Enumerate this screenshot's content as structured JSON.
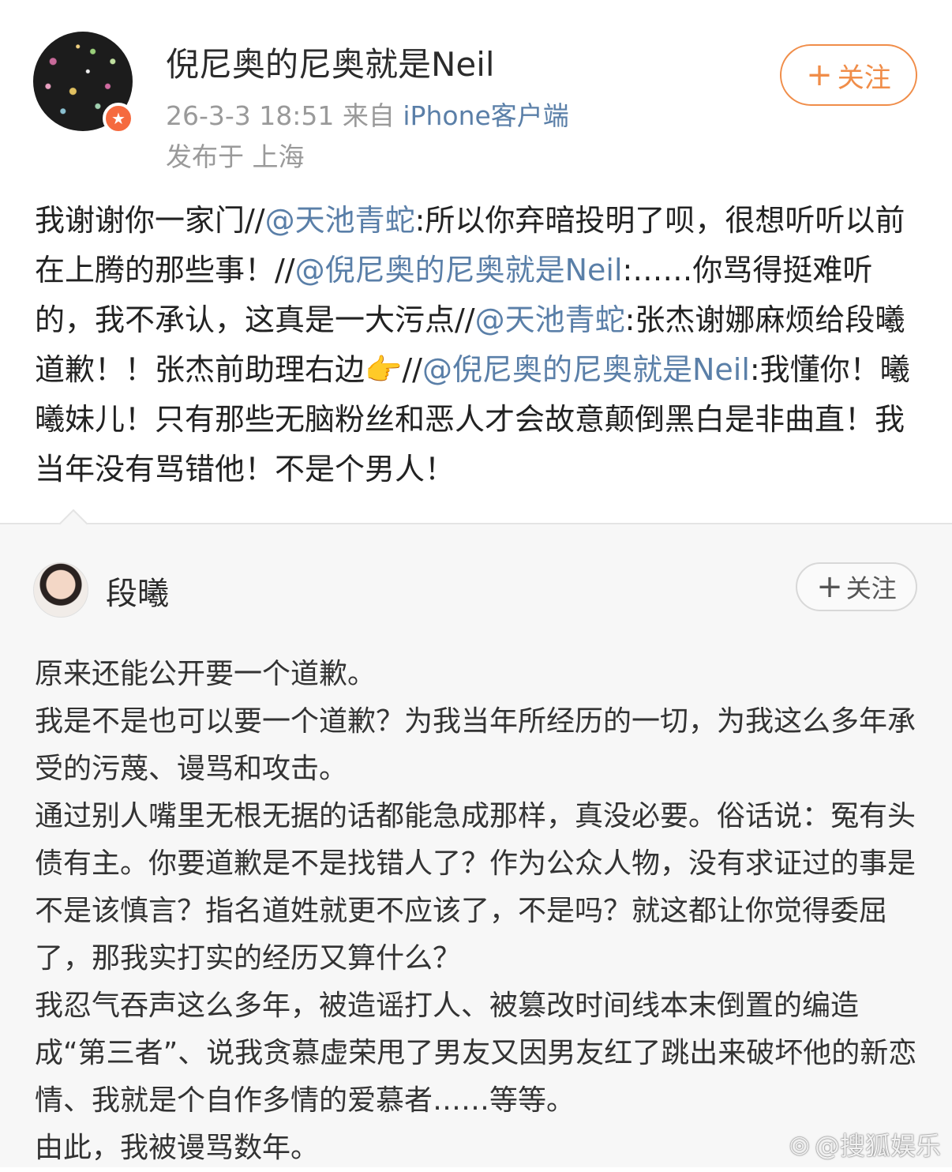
{
  "post": {
    "username": "倪尼奥的尼奥就是Neil",
    "time": "26-3-3 18:51",
    "source_prefix": "来自",
    "source_client": "iPhone客户端",
    "location": "发布于 上海",
    "follow_label": "关注",
    "segments": [
      "我谢谢你一家门//",
      "@天池青蛇",
      ":所以你弃暗投明了呗，很想听听以前在上腾的那些事！//",
      "@倪尼奥的尼奥就是Neil",
      ":……你骂得挺难听的，我不承认，这真是一大污点//",
      "@天池青蛇",
      ":张杰谢娜麻烦给段曦道歉！！张杰前助理右边",
      "👉",
      "//",
      "@倪尼奥的尼奥就是Neil",
      ":我懂你！曦曦妹儿！只有那些无脑粉丝和恶人才会故意颠倒黑白是非曲直！我当年没有骂错他！不是个男人！"
    ]
  },
  "repost": {
    "username": "段曦",
    "follow_label": "关注",
    "paragraphs": [
      "原来还能公开要一个道歉。",
      "我是不是也可以要一个道歉？为我当年所经历的一切，为我这么多年承受的污蔑、谩骂和攻击。",
      "通过别人嘴里无根无据的话都能急成那样，真没必要。俗话说：冤有头债有主。你要道歉是不是找错人了？作为公众人物，没有求证过的事是不是该慎言？指名道姓就更不应该了，不是吗？就这都让你觉得委屈了，那我实打实的经历又算什么？",
      "我忍气吞声这么多年，被造谣打人、被篡改时间线本末倒置的编造成“第三者”、说我贪慕虚荣甩了男友又因男友红了跳出来破坏他的新恋情、我就是个自作多情的爱慕者……等等。",
      "由此，我被谩骂数年。"
    ]
  },
  "watermark": "@搜狐娱乐",
  "colors": {
    "mention": "#5a7fa8",
    "follow_accent": "#f08d49",
    "repost_bg": "#f7f7f7"
  }
}
